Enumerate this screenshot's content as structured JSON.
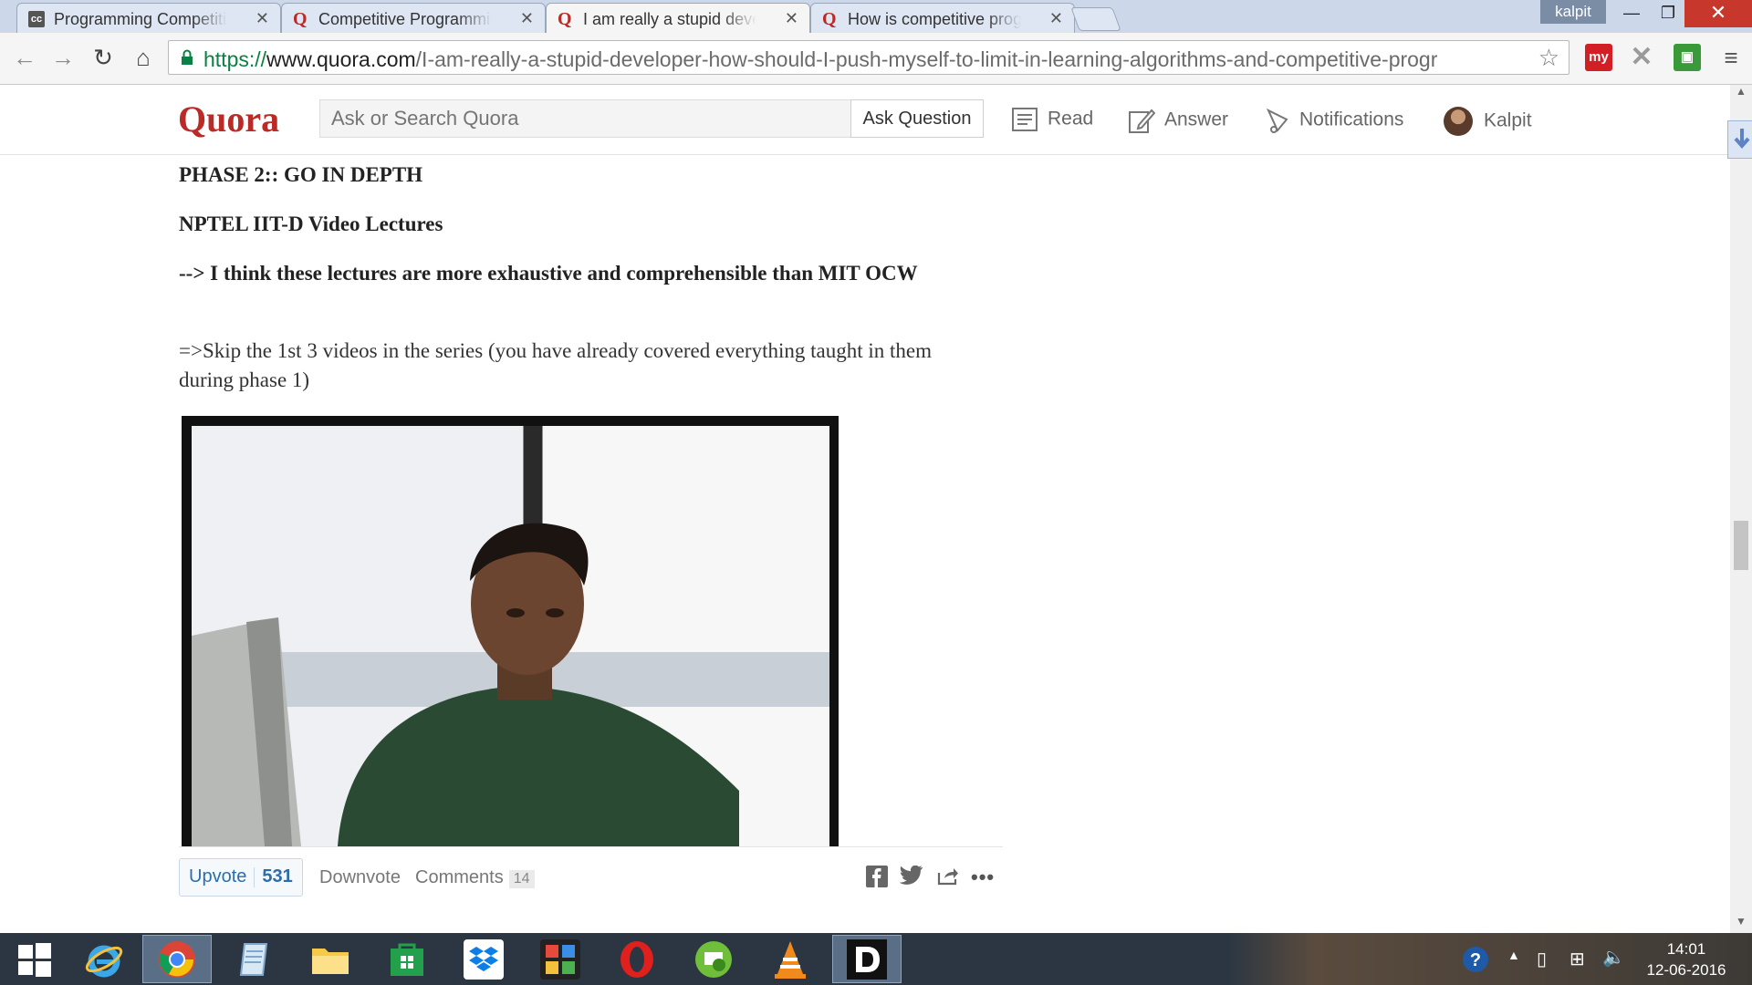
{
  "browser": {
    "tabs": [
      {
        "title": "Programming Competitio",
        "favicon": "cc-icon",
        "active": false
      },
      {
        "title": "Competitive Programmin",
        "favicon": "quora-q-icon",
        "active": false
      },
      {
        "title": "I am really a stupid develo",
        "favicon": "quora-q-icon",
        "active": true
      },
      {
        "title": "How is competitive progra",
        "favicon": "quora-q-icon",
        "active": false
      }
    ],
    "user_badge": "kalpit",
    "url": {
      "scheme": "https://",
      "host": "www.quora.com",
      "path": "/I-am-really-a-stupid-developer-how-should-I-push-myself-to-limit-in-learning-algorithms-and-competitive-progr"
    },
    "extensions": {
      "my": "my"
    }
  },
  "quora": {
    "logo": "Quora",
    "search_placeholder": "Ask or Search Quora",
    "ask_label": "Ask Question",
    "nav": {
      "read": "Read",
      "answer": "Answer",
      "notifications": "Notifications",
      "user": "Kalpit"
    }
  },
  "answer": {
    "heading": "PHASE 2:: GO IN DEPTH",
    "resource": "NPTEL IIT-D Video Lectures",
    "note": "--> I think these lectures are more exhaustive and comprehensible than MIT OCW",
    "skip": "=>Skip the 1st 3 videos in the series (you have already covered everything taught in them during phase 1)"
  },
  "actions": {
    "upvote_label": "Upvote",
    "upvote_count": "531",
    "downvote_label": "Downvote",
    "comments_label": "Comments",
    "comments_count": "14"
  },
  "taskbar": {
    "time": "14:01",
    "date": "12-06-2016"
  },
  "colors": {
    "quora_red": "#b92b27",
    "upvote_blue": "#2b6dad",
    "url_green": "#0b8043"
  }
}
